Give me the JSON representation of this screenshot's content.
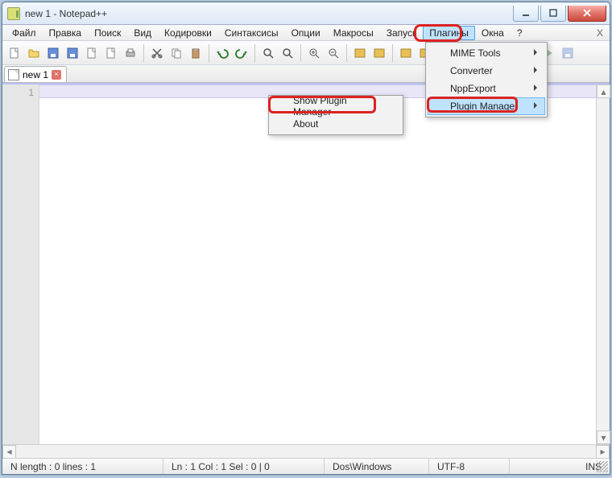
{
  "title": "new 1 - Notepad++",
  "menubar": [
    "Файл",
    "Правка",
    "Поиск",
    "Вид",
    "Кодировки",
    "Синтаксисы",
    "Опции",
    "Макросы",
    "Запуск",
    "Плагины",
    "Окна",
    "?"
  ],
  "open_menu_index": 9,
  "tab": {
    "name": "new 1"
  },
  "gutter": {
    "first_line": "1"
  },
  "plugins_menu": [
    {
      "label": "MIME Tools",
      "submenu": true
    },
    {
      "label": "Converter",
      "submenu": true
    },
    {
      "label": "NppExport",
      "submenu": true
    },
    {
      "label": "Plugin Manager",
      "submenu": true,
      "selected": true
    }
  ],
  "plugin_manager_submenu": [
    {
      "label": "Show Plugin Manager"
    },
    {
      "label": "About"
    }
  ],
  "status": {
    "length": "N length : 0    lines : 1",
    "pos": "Ln : 1    Col : 1    Sel : 0 | 0",
    "eol": "Dos\\Windows",
    "enc": "UTF-8",
    "mode": "INS"
  },
  "toolbar_icons": [
    "new",
    "open",
    "save",
    "save-all",
    "close",
    "close-all",
    "print",
    "sep",
    "cut",
    "copy",
    "paste",
    "sep",
    "undo",
    "redo",
    "sep",
    "find",
    "replace",
    "sep",
    "zoom-in",
    "zoom-out",
    "sep",
    "sync-v",
    "sync-h",
    "sep",
    "wrap",
    "all-chars",
    "indent",
    "lang",
    "sep",
    "macro-rec",
    "macro-stop",
    "macro-play",
    "macro-multi",
    "macro-save"
  ]
}
